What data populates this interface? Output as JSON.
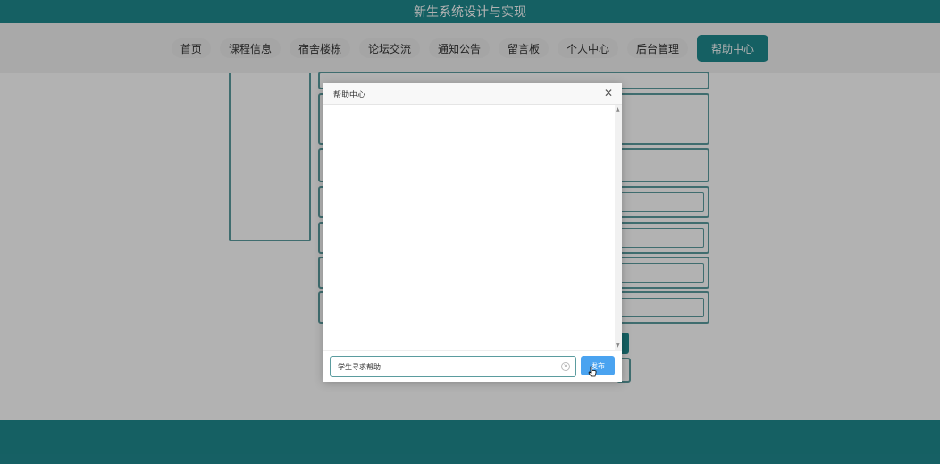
{
  "header": {
    "title": "新生系统设计与实现"
  },
  "nav": {
    "items": [
      {
        "label": "首页"
      },
      {
        "label": "课程信息"
      },
      {
        "label": "宿舍楼栋"
      },
      {
        "label": "论坛交流"
      },
      {
        "label": "通知公告"
      },
      {
        "label": "留言板"
      },
      {
        "label": "个人中心"
      },
      {
        "label": "后台管理"
      },
      {
        "label": "帮助中心",
        "active": true
      }
    ]
  },
  "background": {
    "mark": ""
  },
  "modal": {
    "title": "帮助中心",
    "close_icon": "close-icon",
    "input_value": "学生寻求帮助",
    "send_label": "发布"
  },
  "colors": {
    "brand": "#1f8a8f",
    "nav_bg": "#f2f2f2",
    "send_button": "#4aa3f0"
  }
}
